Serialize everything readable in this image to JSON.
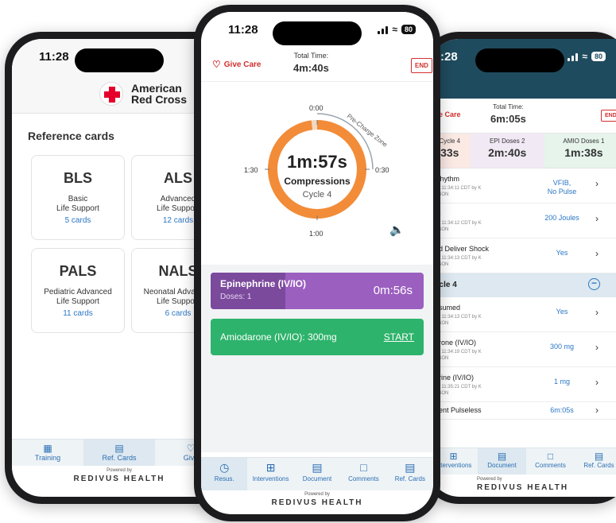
{
  "left": {
    "time": "11:28",
    "brand": "American Red Cross",
    "brand_line1": "American",
    "brand_line2": "Red Cross",
    "section_title": "Reference cards",
    "cards": [
      {
        "abbr": "BLS",
        "full": "Basic\nLife Support",
        "count": "5 cards"
      },
      {
        "abbr": "ALS",
        "full": "Advanced\nLife Support",
        "count": "12 cards"
      },
      {
        "abbr": "PALS",
        "full": "Pediatric Advanced\nLife Support",
        "count": "11 cards"
      },
      {
        "abbr": "NALS",
        "full": "Neonatal Advanced\nLife Support",
        "count": "6 cards"
      }
    ],
    "tabs": [
      "Training",
      "Ref. Cards",
      "Give"
    ],
    "powered_by": "Powered by",
    "powered_brand": "REDIVUS HEALTH"
  },
  "center": {
    "time": "11:28",
    "battery": "80",
    "give_care": "Give Care",
    "total_label": "Total Time:",
    "total_value": "4m:40s",
    "end": "END",
    "ring": {
      "top": "0:00",
      "right": "0:30",
      "bottom": "1:00",
      "left": "1:30",
      "arc_label": "Pre-Charge Zone",
      "time": "1m:57s",
      "phase": "Compressions",
      "cycle": "Cycle 4",
      "progress_fraction": 0.98
    },
    "meds": [
      {
        "name": "Epinephrine (IV/IO)",
        "doses": "Doses: 1",
        "timer": "0m:56s",
        "progress_fraction": 0.35
      },
      {
        "name": "Amiodarone (IV/IO): 300mg",
        "action": "START"
      }
    ],
    "tabs": [
      "Resus.",
      "Interventions",
      "Document",
      "Comments",
      "Ref. Cards"
    ],
    "powered_by": "Powered by",
    "powered_brand": "REDIVUS HEALTH"
  },
  "right": {
    "time": ":28",
    "battery": "80",
    "give_care": "ve Care",
    "total_label": "Total Time:",
    "total_value": "6m:05s",
    "end": "END",
    "timers": [
      {
        "label": "Cycle 4",
        "value": "33s"
      },
      {
        "label": "EPI  Doses 2",
        "value": "2m:40s"
      },
      {
        "label": "AMIO  Doses 1",
        "value": "1m:38s"
      }
    ],
    "rows_top": [
      {
        "title": "Rhythm",
        "sub": "25 11:34:11 CDT by K\nNSON",
        "value": "VFIB,\nNo Pulse"
      },
      {
        "title": "to",
        "sub": "25 11:34:12 CDT by K\nNSON",
        "value": "200 Joules"
      },
      {
        "title": "nd Deliver Shock",
        "sub": "25 11:34:13 CDT by K\nNSON",
        "value": "Yes"
      }
    ],
    "cycle_label": "ycle 4",
    "rows_bottom": [
      {
        "title": "esumed",
        "sub": "25 11:34:13 CDT by K\nNSON",
        "value": "Yes"
      },
      {
        "title": "arone (IV/IO)",
        "sub": "25 11:34:19 CDT by K\nNSON",
        "value": "300 mg"
      },
      {
        "title": "hrine (IV/IO)",
        "sub": "25 11:35:21 CDT by K\nNSON",
        "value": "1 mg"
      },
      {
        "title": "pent Pulseless",
        "sub": "",
        "value": "6m:05s"
      }
    ],
    "tabs": [
      "Interventions",
      "Document",
      "Comments",
      "Ref. Cards"
    ],
    "powered_by": "Powered by",
    "powered_brand": "REDIVUS HEALTH"
  },
  "colors": {
    "ring_orange": "#f28c38",
    "epi_purple": "#9b5fc0",
    "amio_green": "#2db36b",
    "header_teal": "#1f4b5e",
    "link_blue": "#2b76c5",
    "alert_red": "#d32f2f"
  }
}
